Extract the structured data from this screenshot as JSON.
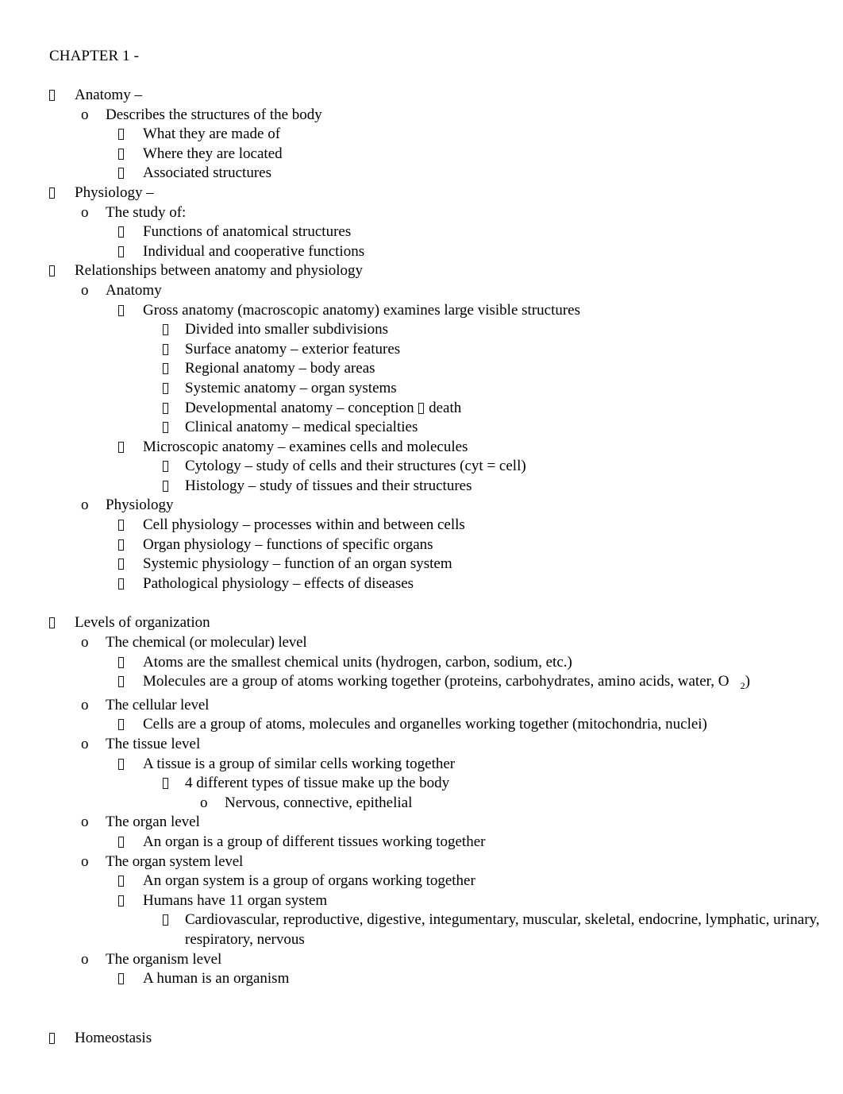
{
  "document": {
    "title": "CHAPTER 1 -",
    "bullet_glyph": "missing-glyph-box",
    "sub_marker": "o",
    "outline": [
      {
        "level": 1,
        "marker": "box",
        "text": "Anatomy –"
      },
      {
        "level": 2,
        "marker": "o",
        "text": "Describes the structures of the body"
      },
      {
        "level": 3,
        "marker": "box",
        "text": "What they are made of"
      },
      {
        "level": 3,
        "marker": "box",
        "text": "Where they are located"
      },
      {
        "level": 3,
        "marker": "box",
        "text": "Associated structures"
      },
      {
        "level": 1,
        "marker": "box",
        "text": "Physiology –"
      },
      {
        "level": 2,
        "marker": "o",
        "text": "The study of:"
      },
      {
        "level": 3,
        "marker": "box",
        "text": "Functions of anatomical structures"
      },
      {
        "level": 3,
        "marker": "box",
        "text": "Individual and cooperative functions"
      },
      {
        "level": 1,
        "marker": "box",
        "text": "Relationships between anatomy and physiology"
      },
      {
        "level": 2,
        "marker": "o",
        "text": "Anatomy"
      },
      {
        "level": 3,
        "marker": "box",
        "text": "Gross anatomy (macroscopic anatomy) examines large visible structures"
      },
      {
        "level": 4,
        "marker": "box",
        "text": "Divided into smaller subdivisions"
      },
      {
        "level": 4,
        "marker": "box",
        "text": "Surface anatomy – exterior features"
      },
      {
        "level": 4,
        "marker": "box",
        "text": "Regional anatomy – body areas"
      },
      {
        "level": 4,
        "marker": "box",
        "text": "Systemic anatomy – organ systems"
      },
      {
        "level": 4,
        "marker": "box",
        "text_before": "Developmental anatomy – conception ",
        "inline_glyph": true,
        "text_after": " death"
      },
      {
        "level": 4,
        "marker": "box",
        "text": "Clinical anatomy – medical specialties"
      },
      {
        "level": 3,
        "marker": "box",
        "text": "Microscopic anatomy – examines cells and molecules"
      },
      {
        "level": 4,
        "marker": "box",
        "text": "Cytology – study of cells and their structures (cyt = cell)"
      },
      {
        "level": 4,
        "marker": "box",
        "text": "Histology – study of tissues and their structures"
      },
      {
        "level": 2,
        "marker": "o",
        "text": "Physiology"
      },
      {
        "level": 3,
        "marker": "box",
        "text": "Cell physiology – processes within and between cells"
      },
      {
        "level": 3,
        "marker": "box",
        "text": "Organ physiology – functions of specific organs"
      },
      {
        "level": 3,
        "marker": "box",
        "text": "Systemic physiology – function of an organ system"
      },
      {
        "level": 3,
        "marker": "box",
        "text": "Pathological physiology – effects of diseases"
      },
      {
        "level": 1,
        "marker": "box",
        "text": "Levels of organization"
      },
      {
        "level": 2,
        "marker": "o",
        "text": "The chemical (or molecular) level"
      },
      {
        "level": 3,
        "marker": "box",
        "text": "Atoms are the smallest chemical units (hydrogen, carbon, sodium, etc.)"
      },
      {
        "level": 3,
        "marker": "box",
        "text_before": "Molecules are a group of atoms working together (proteins, carbohydrates, amino acids, water, O",
        "subscript": "2",
        "text_after": ")"
      },
      {
        "level": 2,
        "marker": "o",
        "text": "The cellular level"
      },
      {
        "level": 3,
        "marker": "box",
        "text": "Cells are a group of atoms, molecules and organelles working together (mitochondria, nuclei)"
      },
      {
        "level": 2,
        "marker": "o",
        "text": "The tissue level"
      },
      {
        "level": 3,
        "marker": "box",
        "text": "A tissue is a group of similar cells working together"
      },
      {
        "level": 4,
        "marker": "box",
        "text": "4 different types of tissue make up the body"
      },
      {
        "level": 5,
        "marker": "o",
        "text": "Nervous, connective, epithelial"
      },
      {
        "level": 2,
        "marker": "o",
        "text": "The organ level"
      },
      {
        "level": 3,
        "marker": "box",
        "text": "An organ is a group of different tissues working together"
      },
      {
        "level": 2,
        "marker": "o",
        "text": "The organ system level"
      },
      {
        "level": 3,
        "marker": "box",
        "text": "An organ system is a group of organs working together"
      },
      {
        "level": 3,
        "marker": "box",
        "text": "Humans have 11 organ system"
      },
      {
        "level": 4,
        "marker": "box",
        "text": "Cardiovascular, reproductive, digestive, integumentary, muscular, skeletal, endocrine, lymphatic, urinary, respiratory, nervous"
      },
      {
        "level": 2,
        "marker": "o",
        "text": "The organism level"
      },
      {
        "level": 3,
        "marker": "box",
        "text": "A human is an organism"
      },
      {
        "level": 1,
        "marker": "box",
        "text": "Homeostasis"
      }
    ]
  }
}
